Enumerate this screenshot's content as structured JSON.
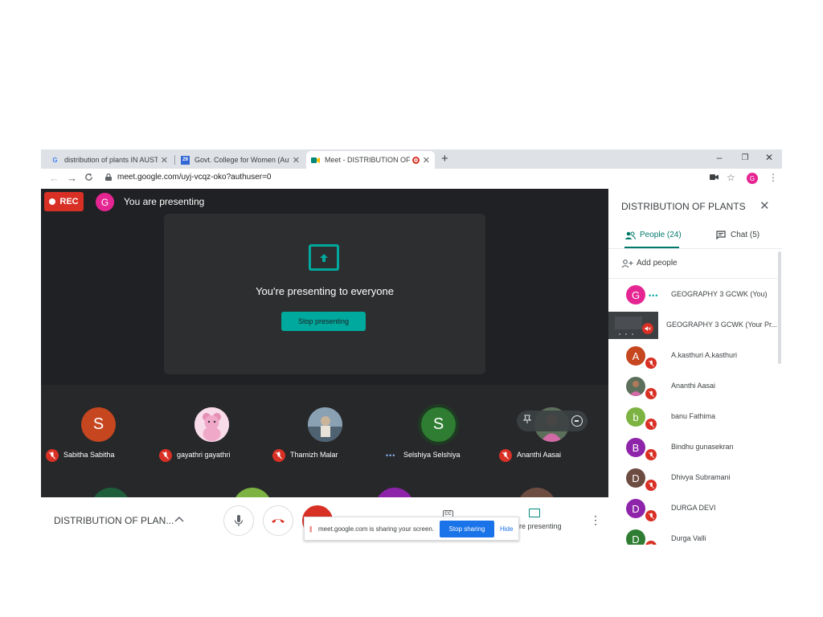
{
  "browser": {
    "tabs": [
      {
        "title": "distribution of plants IN AUSTRA",
        "favicon": "G",
        "favicon_color": "#4285f4"
      },
      {
        "title": "Govt. College for Women (Auton",
        "favicon": "29",
        "favicon_color": "#3367d6"
      },
      {
        "title": "Meet - DISTRIBUTION OF PL",
        "favicon": "meet-icon",
        "favicon_color": "#00897b"
      }
    ],
    "new_tab": "+",
    "window_controls": {
      "minimize": "–",
      "maximize": "❐",
      "close": "✕"
    },
    "nav": {
      "back": "←",
      "forward": "→",
      "reload": "C"
    },
    "url": "meet.google.com/uyj-vcqz-oko?authuser=0",
    "profile_initial": "G"
  },
  "meet": {
    "rec_label": "REC",
    "presenter_initial": "G",
    "presenting_label": "You are presenting",
    "center_message": "You're presenting to everyone",
    "stop_presenting_label": "Stop presenting",
    "participants": [
      {
        "name": "Sabitha Sabitha",
        "initial": "S",
        "color": "#c5461f",
        "muted": true
      },
      {
        "name": "gayathri gayathri",
        "initial": "",
        "color": "#f4c0d8",
        "muted": true,
        "photo": "teddy-bear"
      },
      {
        "name": "Thamizh Malar",
        "initial": "",
        "color": "#6b7f92",
        "muted": true,
        "photo": "person"
      },
      {
        "name": "Selshiya Selshiya",
        "initial": "S",
        "color": "#2e7d32",
        "muted": false,
        "speaking": true
      },
      {
        "name": "Ananthi Aasai",
        "initial": "",
        "color": "#8a6e8f",
        "muted": true,
        "photo": "person"
      }
    ],
    "meeting_title": "DISTRIBUTION OF PLAN...",
    "present_label": "are presenting",
    "cc_label": "CC",
    "sharing_bar": {
      "message": "meet.google.com is sharing your screen.",
      "stop_label": "Stop sharing",
      "hide_label": "Hide"
    }
  },
  "panel": {
    "title": "DISTRIBUTION OF PLANTS",
    "people_tab": "People (24)",
    "chat_tab": "Chat (5)",
    "add_people": "Add people",
    "people": [
      {
        "name": "GEOGRAPHY 3 GCWK (You)",
        "initial": "G",
        "color": "#e52592",
        "muted": false,
        "speaking": true
      },
      {
        "name": "GEOGRAPHY 3 GCWK (Your Pr...",
        "initial": "",
        "color": "#3c4043",
        "muted": true,
        "presentation": true
      },
      {
        "name": "A.kasthuri A.kasthuri",
        "initial": "A",
        "color": "#c5461f",
        "muted": true
      },
      {
        "name": "Ananthi Aasai",
        "initial": "",
        "color": "#8a6e8f",
        "muted": true,
        "photo": true
      },
      {
        "name": "banu Fathima",
        "initial": "b",
        "color": "#7cb342",
        "muted": true
      },
      {
        "name": "Bindhu gunasekran",
        "initial": "B",
        "color": "#8e24aa",
        "muted": true
      },
      {
        "name": "Dhivya Subramani",
        "initial": "D",
        "color": "#6d4c41",
        "muted": true
      },
      {
        "name": "DURGA DEVI",
        "initial": "D",
        "color": "#8e24aa",
        "muted": true
      },
      {
        "name": "Durga Valli",
        "initial": "D",
        "color": "#2e7d32",
        "muted": true
      }
    ]
  }
}
